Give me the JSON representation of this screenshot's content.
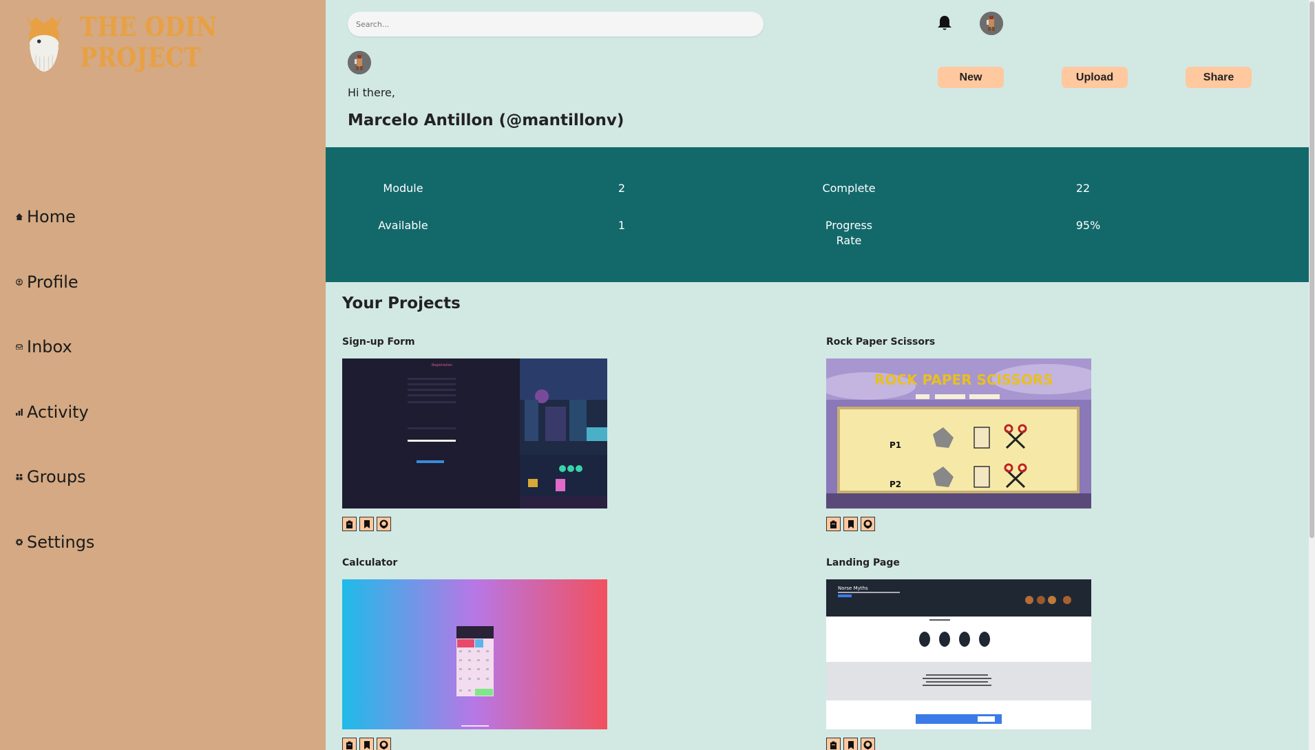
{
  "brand": {
    "name": "THE ODIN PROJECT"
  },
  "sidebar": {
    "items": [
      {
        "label": "Home",
        "icon": "home-icon"
      },
      {
        "label": "Profile",
        "icon": "profile-icon"
      },
      {
        "label": "Inbox",
        "icon": "inbox-icon"
      },
      {
        "label": "Activity",
        "icon": "activity-icon"
      },
      {
        "label": "Groups",
        "icon": "groups-icon"
      },
      {
        "label": "Settings",
        "icon": "settings-icon"
      }
    ]
  },
  "header": {
    "search_placeholder": "Search...",
    "greeting": "Hi there,",
    "user": "Marcelo Antillon (@mantillonv)",
    "buttons": {
      "new": "New",
      "upload": "Upload",
      "share": "Share"
    }
  },
  "stats": {
    "module_label": "Module",
    "module_value": "2",
    "available_label": "Available",
    "available_value": "1",
    "complete_label": "Complete",
    "complete_value": "22",
    "progress_label_1": "Progress",
    "progress_label_2": "Rate",
    "progress_value": "95%"
  },
  "projects": {
    "title": "Your Projects",
    "items": [
      {
        "name": "Sign-up Form"
      },
      {
        "name": "Rock Paper Scissors"
      },
      {
        "name": "Calculator"
      },
      {
        "name": "Landing Page"
      }
    ]
  },
  "colors": {
    "sidebar": "#d4a983",
    "background": "#d2e8e3",
    "stats_band": "#13686a",
    "button": "#ffc89e",
    "brand": "#e8a042"
  }
}
